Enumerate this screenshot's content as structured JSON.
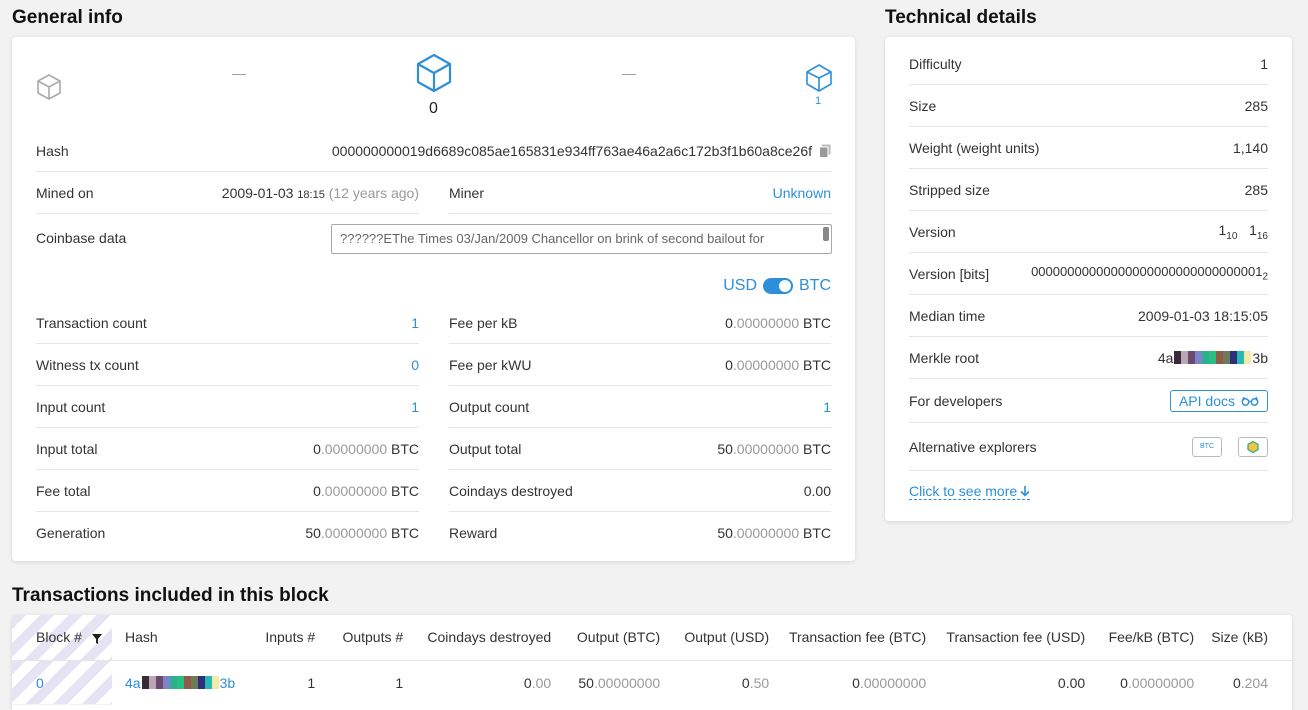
{
  "general": {
    "title": "General info",
    "prev_dash": "—",
    "next_dash": "—",
    "current_block": "0",
    "next_block": "1",
    "hash_label": "Hash",
    "hash_value": "000000000019d6689c085ae165831e934ff763ae46a2a6c172b3f1b60a8ce26f",
    "mined_on_label": "Mined on",
    "mined_on_date": "2009-01-03",
    "mined_on_time": "18:15",
    "mined_on_ago": "(12 years ago)",
    "miner_label": "Miner",
    "miner_value": "Unknown",
    "coinbase_label": "Coinbase data",
    "coinbase_prefix": "??????E",
    "coinbase_text": "The Times 03/Jan/2009 Chancellor on brink of second bailout for",
    "currency_usd": "USD",
    "currency_btc": "BTC",
    "left_rows": [
      {
        "label": "Transaction count",
        "value": "1"
      },
      {
        "label": "Witness tx count",
        "value": "0"
      },
      {
        "label": "Input count",
        "value": "1"
      },
      {
        "label": "Input total",
        "int": "0",
        "dec": ".00000000",
        "unit": "BTC"
      },
      {
        "label": "Fee total",
        "int": "0",
        "dec": ".00000000",
        "unit": "BTC"
      },
      {
        "label": "Generation",
        "int": "50",
        "dec": ".00000000",
        "unit": "BTC"
      }
    ],
    "right_rows": [
      {
        "label": "Fee per kB",
        "int": "0",
        "dec": ".00000000",
        "unit": "BTC"
      },
      {
        "label": "Fee per kWU",
        "int": "0",
        "dec": ".00000000",
        "unit": "BTC"
      },
      {
        "label": "Output count",
        "value": "1"
      },
      {
        "label": "Output total",
        "int": "50",
        "dec": ".00000000",
        "unit": "BTC"
      },
      {
        "label": "Coindays destroyed",
        "value": "0.00"
      },
      {
        "label": "Reward",
        "int": "50",
        "dec": ".00000000",
        "unit": "BTC"
      }
    ]
  },
  "technical": {
    "title": "Technical details",
    "rows": [
      {
        "label": "Difficulty",
        "value": "1"
      },
      {
        "label": "Size",
        "value": "285"
      },
      {
        "label": "Weight (weight units)",
        "value": "1,140"
      },
      {
        "label": "Stripped size",
        "value": "285"
      }
    ],
    "version_label": "Version",
    "version_a": "1",
    "version_a_sub": "10",
    "version_b": "1",
    "version_b_sub": "16",
    "version_bits_label": "Version [bits]",
    "version_bits_value": "00000000000000000000000000000001",
    "version_bits_sub": "2",
    "median_label": "Median time",
    "median_value": "2009-01-03 18:15:05",
    "merkle_label": "Merkle root",
    "merkle_start": "4a",
    "merkle_end": "3b",
    "dev_label": "For developers",
    "api_docs": "API docs",
    "alt_label": "Alternative explorers",
    "alt_btc": "BTC",
    "see_more": "Click to see more"
  },
  "transactions": {
    "title": "Transactions included in this block",
    "headers": [
      "Block #",
      "Hash",
      "Inputs #",
      "Outputs #",
      "Coindays destroyed",
      "Output (BTC)",
      "Output (USD)",
      "Transaction fee (BTC)",
      "Transaction fee (USD)",
      "Fee/kB (BTC)",
      "Size (kB)"
    ],
    "row": {
      "block": "0",
      "hash_start": "4a",
      "hash_end": "3b",
      "inputs": "1",
      "outputs": "1",
      "cdd_int": "0",
      "cdd_dec": ".00",
      "out_btc_int": "50",
      "out_btc_dec": ".00000000",
      "out_usd_int": "0",
      "out_usd_dec": ".50",
      "fee_btc_int": "0",
      "fee_btc_dec": ".00000000",
      "fee_usd": "0.00",
      "feekb_int": "0",
      "feekb_dec": ".00000000",
      "size_int": "0",
      "size_dec": ".204"
    }
  },
  "hash_colors": [
    "#3b2a3a",
    "#b7a8b4",
    "#6b4a6e",
    "#7c84c9",
    "#2dae8f",
    "#27c081",
    "#8f5a4a",
    "#6e7b5a",
    "#2c2f7a",
    "#27b7b5",
    "#f3e9a8"
  ],
  "colors": {
    "accent": "#2d8fd9"
  }
}
